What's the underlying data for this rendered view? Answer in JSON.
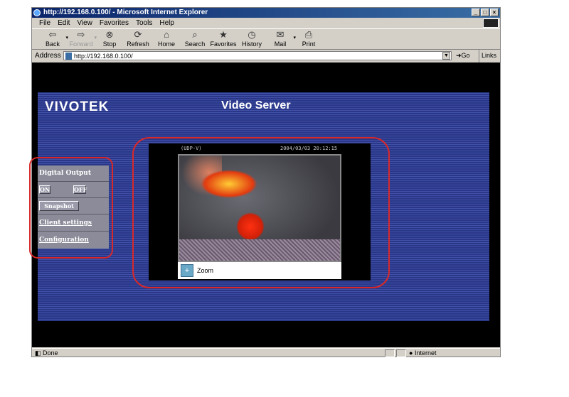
{
  "window": {
    "title": "http://192.168.0.100/ - Microsoft Internet Explorer",
    "controls": [
      "_",
      "□",
      "×"
    ]
  },
  "menu": [
    "File",
    "Edit",
    "View",
    "Favorites",
    "Tools",
    "Help"
  ],
  "toolbar": [
    {
      "label": "Back",
      "icon": "back-arrow-icon"
    },
    {
      "label": "Forward",
      "icon": "forward-arrow-icon"
    },
    {
      "label": "Stop",
      "icon": "stop-icon"
    },
    {
      "label": "Refresh",
      "icon": "refresh-icon"
    },
    {
      "label": "Home",
      "icon": "home-icon"
    },
    {
      "label": "Search",
      "icon": "search-icon"
    },
    {
      "label": "Favorites",
      "icon": "favorites-icon"
    },
    {
      "label": "History",
      "icon": "history-icon"
    },
    {
      "label": "Mail",
      "icon": "mail-icon"
    },
    {
      "label": "Print",
      "icon": "print-icon"
    }
  ],
  "address": {
    "label": "Address",
    "url": "http://192.168.0.100/",
    "go": "Go",
    "links": "Links »"
  },
  "page": {
    "logo": "VIVOTEK",
    "title": "Video Server",
    "menu": {
      "digital_output": "Digital Output",
      "on": "ON",
      "off": "OFF",
      "snapshot": "Snapshot",
      "client_settings": "Client settings",
      "configuration": "Configuration"
    },
    "video": {
      "mode": "(UDP-V)",
      "timestamp": "2004/03/03 20:12:15",
      "zoom": "Zoom"
    }
  },
  "status": {
    "text": "Done",
    "zone": "Internet"
  },
  "colors": {
    "panel": "#2a3788",
    "highlight": "#d8282a",
    "titlebar": "#0a246a"
  }
}
